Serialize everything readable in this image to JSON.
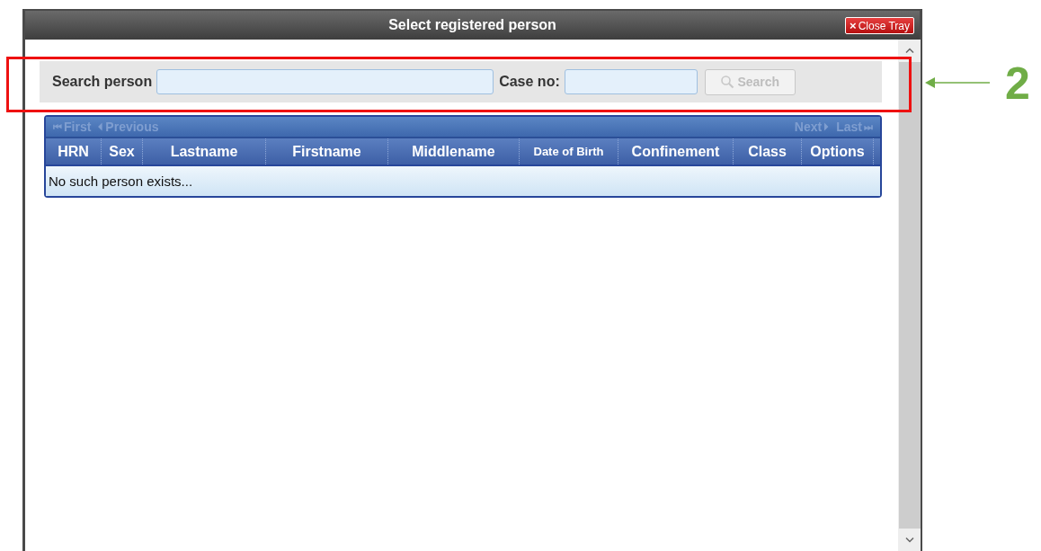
{
  "dialog": {
    "title": "Select registered person",
    "close_button": {
      "icon": "×",
      "label": "Close Tray"
    }
  },
  "search": {
    "person_label": "Search person",
    "case_label": "Case no:",
    "button": {
      "label": "Search",
      "disabled": true
    }
  },
  "pager": {
    "left": [
      {
        "icon": "⏮",
        "label": "First",
        "disabled": true
      },
      {
        "icon": "⏴",
        "label": "Previous",
        "disabled": true
      }
    ],
    "right": [
      {
        "icon": "⏵",
        "label": "Next",
        "disabled": true,
        "icon_after": true
      },
      {
        "icon": "⏭",
        "label": "Last",
        "disabled": true,
        "icon_after": true
      }
    ]
  },
  "table": {
    "columns": [
      {
        "label": "HRN",
        "small": false
      },
      {
        "label": "Sex",
        "small": false
      },
      {
        "label": "Lastname",
        "small": false
      },
      {
        "label": "Firstname",
        "small": false
      },
      {
        "label": "Middlename",
        "small": false
      },
      {
        "label": "Date of Birth",
        "small": true
      },
      {
        "label": "Confinement",
        "small": false
      },
      {
        "label": "Class",
        "small": false
      },
      {
        "label": "Options",
        "small": false
      }
    ],
    "empty_message": "No such person exists..."
  },
  "annotation": {
    "number": "2"
  }
}
